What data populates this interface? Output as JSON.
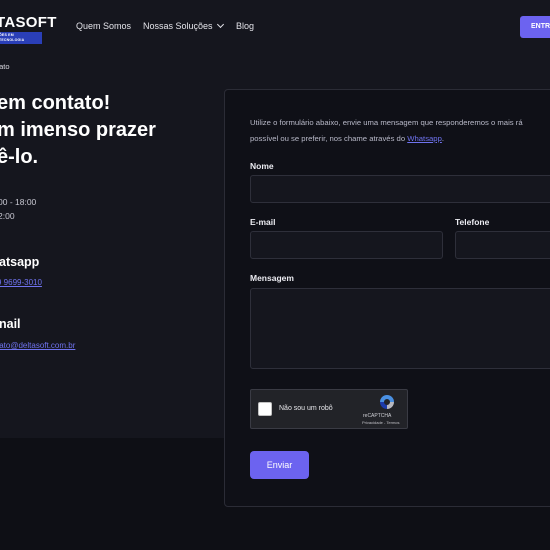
{
  "nav": {
    "logo": "TASOFT",
    "logo_tagline": "ÕES EM TECNOLOGIA",
    "links": [
      "Quem Somos",
      "Nossas Soluções",
      "Blog"
    ],
    "cta_label": "ENTR"
  },
  "breadcrumb": "tato",
  "hero": {
    "line1": "em contato!",
    "line2": "m imenso prazer",
    "line3": "ê-lo."
  },
  "hours": {
    "line1": "00 - 18:00",
    "line2": "2:00"
  },
  "whatsapp": {
    "title": "atsapp",
    "number": "9 9699-3010"
  },
  "email": {
    "title": "nail",
    "address": "tato@deltasoft.com.br"
  },
  "form": {
    "intro_line1": "Utilize o formulário abaixo, envie uma mensagem que responderemos o mais rá",
    "intro_line2_prefix": "possível ou se preferir, nos chame através do ",
    "intro_link": "Whatsapp",
    "intro_line2_suffix": ".",
    "name_label": "Nome",
    "email_label": "E-mail",
    "phone_label": "Telefone",
    "message_label": "Mensagem",
    "name_value": "",
    "email_value": "",
    "phone_value": "",
    "message_value": "",
    "captcha_label": "Não sou um robô",
    "captcha_brand": "reCAPTCHA",
    "captcha_links": "Privacidade - Termos",
    "submit_label": "Enviar"
  },
  "colors": {
    "accent": "#6c63f0",
    "link": "#6f73ef",
    "background": "#0e0f15",
    "panel": "#15161e"
  }
}
